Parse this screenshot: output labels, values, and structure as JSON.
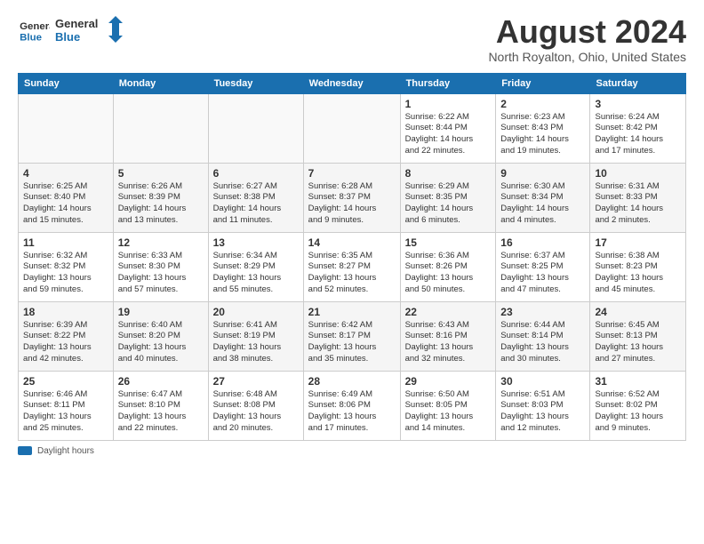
{
  "header": {
    "logo_line1": "General",
    "logo_line2": "Blue",
    "title": "August 2024",
    "location": "North Royalton, Ohio, United States"
  },
  "days_of_week": [
    "Sunday",
    "Monday",
    "Tuesday",
    "Wednesday",
    "Thursday",
    "Friday",
    "Saturday"
  ],
  "weeks": [
    [
      {
        "day": "",
        "info": ""
      },
      {
        "day": "",
        "info": ""
      },
      {
        "day": "",
        "info": ""
      },
      {
        "day": "",
        "info": ""
      },
      {
        "day": "1",
        "info": "Sunrise: 6:22 AM\nSunset: 8:44 PM\nDaylight: 14 hours\nand 22 minutes."
      },
      {
        "day": "2",
        "info": "Sunrise: 6:23 AM\nSunset: 8:43 PM\nDaylight: 14 hours\nand 19 minutes."
      },
      {
        "day": "3",
        "info": "Sunrise: 6:24 AM\nSunset: 8:42 PM\nDaylight: 14 hours\nand 17 minutes."
      }
    ],
    [
      {
        "day": "4",
        "info": "Sunrise: 6:25 AM\nSunset: 8:40 PM\nDaylight: 14 hours\nand 15 minutes."
      },
      {
        "day": "5",
        "info": "Sunrise: 6:26 AM\nSunset: 8:39 PM\nDaylight: 14 hours\nand 13 minutes."
      },
      {
        "day": "6",
        "info": "Sunrise: 6:27 AM\nSunset: 8:38 PM\nDaylight: 14 hours\nand 11 minutes."
      },
      {
        "day": "7",
        "info": "Sunrise: 6:28 AM\nSunset: 8:37 PM\nDaylight: 14 hours\nand 9 minutes."
      },
      {
        "day": "8",
        "info": "Sunrise: 6:29 AM\nSunset: 8:35 PM\nDaylight: 14 hours\nand 6 minutes."
      },
      {
        "day": "9",
        "info": "Sunrise: 6:30 AM\nSunset: 8:34 PM\nDaylight: 14 hours\nand 4 minutes."
      },
      {
        "day": "10",
        "info": "Sunrise: 6:31 AM\nSunset: 8:33 PM\nDaylight: 14 hours\nand 2 minutes."
      }
    ],
    [
      {
        "day": "11",
        "info": "Sunrise: 6:32 AM\nSunset: 8:32 PM\nDaylight: 13 hours\nand 59 minutes."
      },
      {
        "day": "12",
        "info": "Sunrise: 6:33 AM\nSunset: 8:30 PM\nDaylight: 13 hours\nand 57 minutes."
      },
      {
        "day": "13",
        "info": "Sunrise: 6:34 AM\nSunset: 8:29 PM\nDaylight: 13 hours\nand 55 minutes."
      },
      {
        "day": "14",
        "info": "Sunrise: 6:35 AM\nSunset: 8:27 PM\nDaylight: 13 hours\nand 52 minutes."
      },
      {
        "day": "15",
        "info": "Sunrise: 6:36 AM\nSunset: 8:26 PM\nDaylight: 13 hours\nand 50 minutes."
      },
      {
        "day": "16",
        "info": "Sunrise: 6:37 AM\nSunset: 8:25 PM\nDaylight: 13 hours\nand 47 minutes."
      },
      {
        "day": "17",
        "info": "Sunrise: 6:38 AM\nSunset: 8:23 PM\nDaylight: 13 hours\nand 45 minutes."
      }
    ],
    [
      {
        "day": "18",
        "info": "Sunrise: 6:39 AM\nSunset: 8:22 PM\nDaylight: 13 hours\nand 42 minutes."
      },
      {
        "day": "19",
        "info": "Sunrise: 6:40 AM\nSunset: 8:20 PM\nDaylight: 13 hours\nand 40 minutes."
      },
      {
        "day": "20",
        "info": "Sunrise: 6:41 AM\nSunset: 8:19 PM\nDaylight: 13 hours\nand 38 minutes."
      },
      {
        "day": "21",
        "info": "Sunrise: 6:42 AM\nSunset: 8:17 PM\nDaylight: 13 hours\nand 35 minutes."
      },
      {
        "day": "22",
        "info": "Sunrise: 6:43 AM\nSunset: 8:16 PM\nDaylight: 13 hours\nand 32 minutes."
      },
      {
        "day": "23",
        "info": "Sunrise: 6:44 AM\nSunset: 8:14 PM\nDaylight: 13 hours\nand 30 minutes."
      },
      {
        "day": "24",
        "info": "Sunrise: 6:45 AM\nSunset: 8:13 PM\nDaylight: 13 hours\nand 27 minutes."
      }
    ],
    [
      {
        "day": "25",
        "info": "Sunrise: 6:46 AM\nSunset: 8:11 PM\nDaylight: 13 hours\nand 25 minutes."
      },
      {
        "day": "26",
        "info": "Sunrise: 6:47 AM\nSunset: 8:10 PM\nDaylight: 13 hours\nand 22 minutes."
      },
      {
        "day": "27",
        "info": "Sunrise: 6:48 AM\nSunset: 8:08 PM\nDaylight: 13 hours\nand 20 minutes."
      },
      {
        "day": "28",
        "info": "Sunrise: 6:49 AM\nSunset: 8:06 PM\nDaylight: 13 hours\nand 17 minutes."
      },
      {
        "day": "29",
        "info": "Sunrise: 6:50 AM\nSunset: 8:05 PM\nDaylight: 13 hours\nand 14 minutes."
      },
      {
        "day": "30",
        "info": "Sunrise: 6:51 AM\nSunset: 8:03 PM\nDaylight: 13 hours\nand 12 minutes."
      },
      {
        "day": "31",
        "info": "Sunrise: 6:52 AM\nSunset: 8:02 PM\nDaylight: 13 hours\nand 9 minutes."
      }
    ]
  ],
  "legend": {
    "daylight_label": "Daylight hours"
  }
}
